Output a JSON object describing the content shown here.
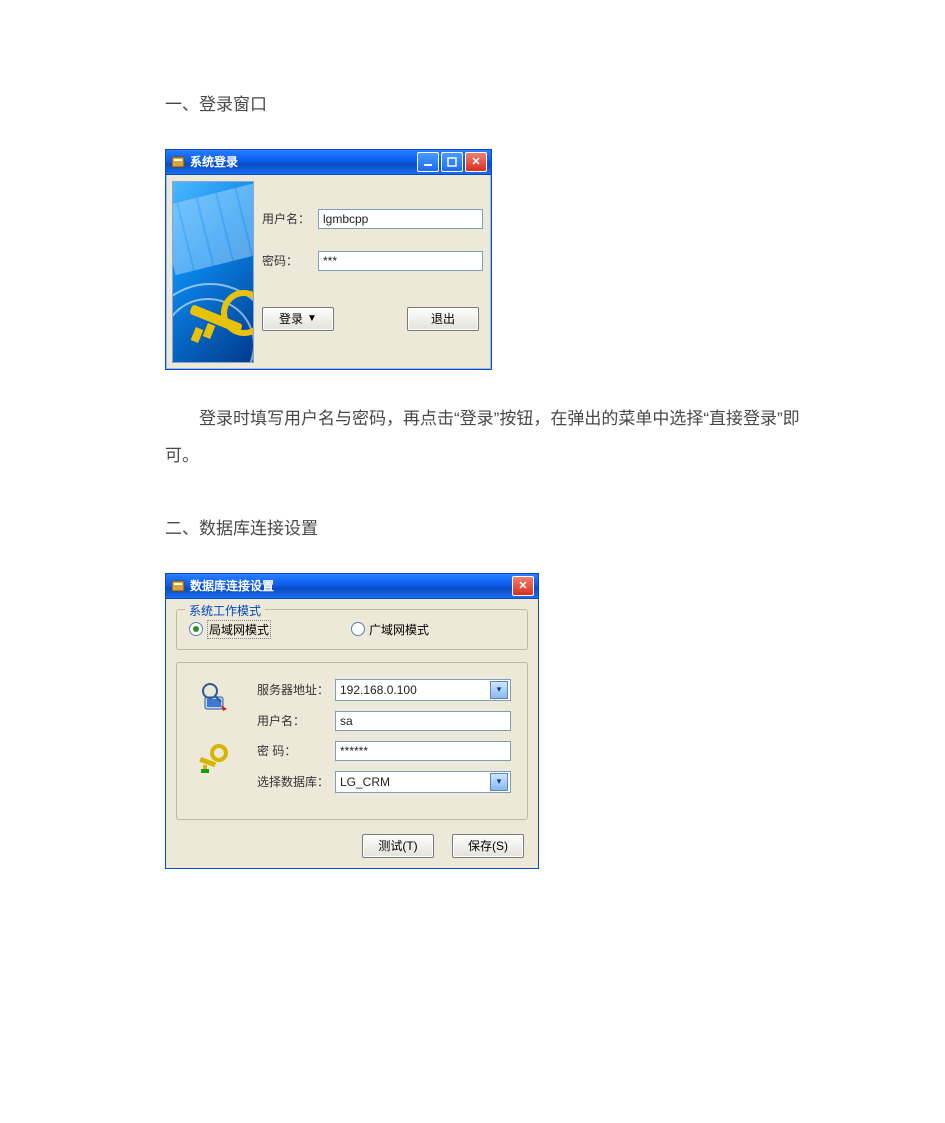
{
  "section1_heading": "一、登录窗口",
  "login_window": {
    "title": "系统登录",
    "username_label": "用户名：",
    "username_value": "lgmbcpp",
    "password_label": "密码：",
    "password_value": "***",
    "login_button": "登录",
    "exit_button": "退出"
  },
  "paragraph1": "登录时填写用户名与密码，再点击“登录”按钮，在弹出的菜单中选择“直接登录”即可。",
  "section2_heading": "二、数据库连接设置",
  "db_window": {
    "title": "数据库连接设置",
    "group_title": "系统工作模式",
    "radio_lan": "局域网模式",
    "radio_wan": "广域网模式",
    "server_label": "服务器地址：",
    "server_value": "192.168.0.100",
    "user_label": "用户名：",
    "user_value": "sa",
    "pwd_label": "密  码：",
    "pwd_value": "******",
    "db_label": "选择数据库：",
    "db_value": "LG_CRM",
    "test_button": "测试(T)",
    "save_button": "保存(S)"
  }
}
